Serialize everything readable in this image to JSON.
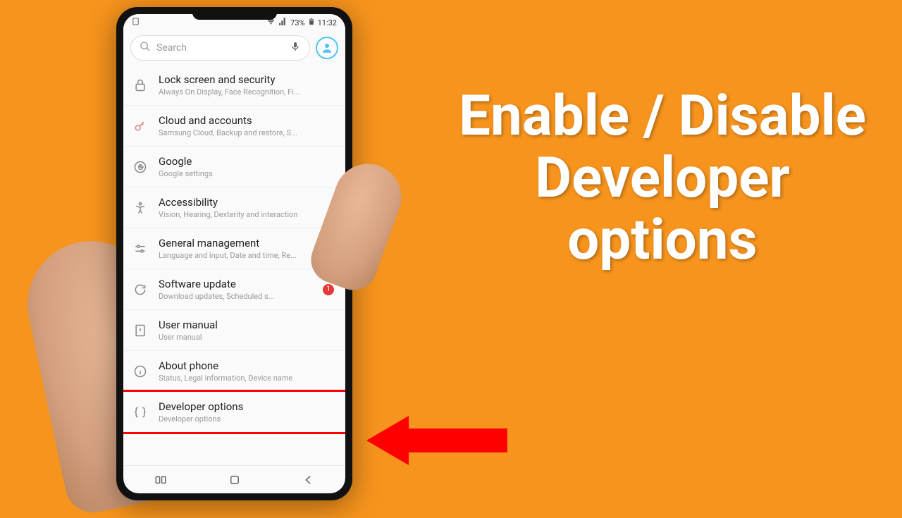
{
  "status": {
    "battery_pct": "73%",
    "time": "11:32"
  },
  "search": {
    "placeholder": "Search"
  },
  "settings": [
    {
      "icon": "lock",
      "title": "Lock screen and security",
      "sub": "Always On Display, Face Recognition, Fi..."
    },
    {
      "icon": "key",
      "title": "Cloud and accounts",
      "sub": "Samsung Cloud, Backup and restore, S..."
    },
    {
      "icon": "google",
      "title": "Google",
      "sub": "Google settings"
    },
    {
      "icon": "accessibility",
      "title": "Accessibility",
      "sub": "Vision, Hearing, Dexterity and interaction"
    },
    {
      "icon": "sliders",
      "title": "General management",
      "sub": "Language and input, Date and time, Re..."
    },
    {
      "icon": "refresh",
      "title": "Software update",
      "sub": "Download updates, Scheduled s...",
      "badge": "1"
    },
    {
      "icon": "manual",
      "title": "User manual",
      "sub": "User manual"
    },
    {
      "icon": "info",
      "title": "About phone",
      "sub": "Status, Legal information, Device name"
    },
    {
      "icon": "braces",
      "title": "Developer options",
      "sub": "Developer options",
      "highlight": true
    }
  ],
  "overlay": {
    "line1": "Enable / Disable",
    "line2": "Developer",
    "line3": "options"
  }
}
